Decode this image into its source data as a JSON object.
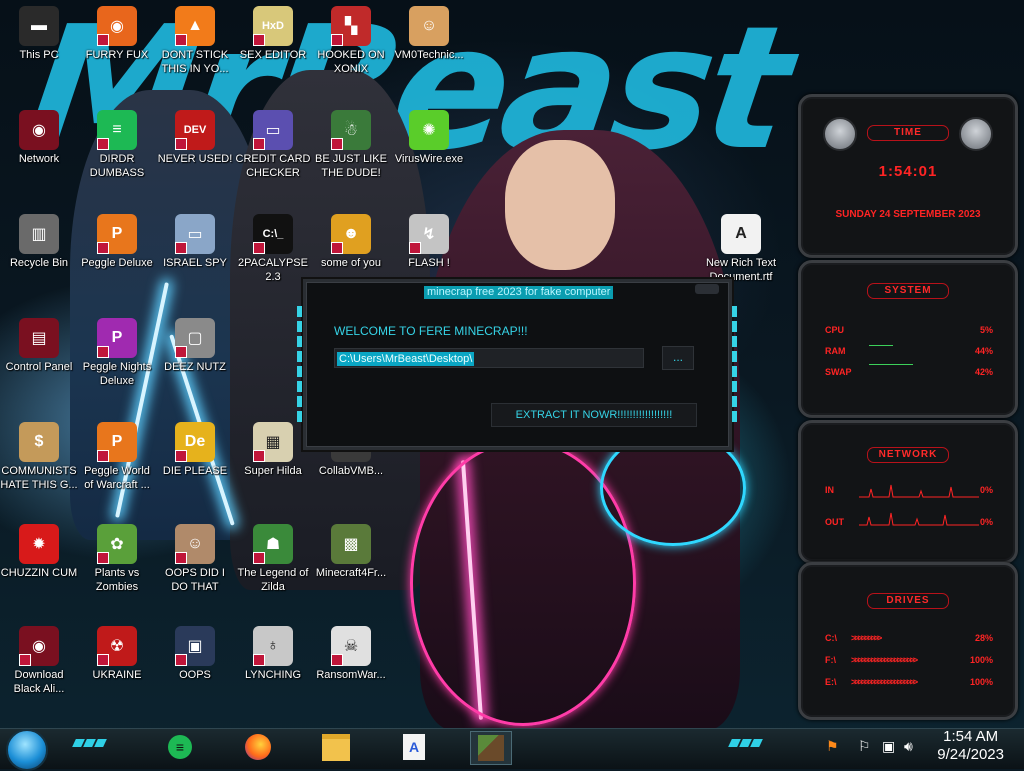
{
  "desktop": {
    "icons": [
      {
        "label": "This PC",
        "glyph": "▬",
        "bg": "#2a2a2a",
        "shortcut": false
      },
      {
        "label": "FURRY FUX",
        "glyph": "◉",
        "bg": "#e8661c",
        "shortcut": true
      },
      {
        "label": "DONT STICK THIS IN YO...",
        "glyph": "▲",
        "bg": "#f27b1a",
        "shortcut": true
      },
      {
        "label": "SEX EDITOR",
        "glyph": "HxD",
        "bg": "#d8c87a",
        "shortcut": true
      },
      {
        "label": "HOOKED ON XONIX",
        "glyph": "▚",
        "bg": "#c02a2a",
        "shortcut": true
      },
      {
        "label": "VM0Technic...",
        "glyph": "☺",
        "bg": "#d8a060",
        "shortcut": false
      },
      {
        "label": "Network",
        "glyph": "◉",
        "bg": "#7a1020",
        "shortcut": false
      },
      {
        "label": "DIRDR DUMBASS",
        "glyph": "≡",
        "bg": "#1db954",
        "shortcut": true
      },
      {
        "label": "NEVER USED!",
        "glyph": "DEV",
        "bg": "#c01a1a",
        "shortcut": true
      },
      {
        "label": "CREDIT CARD CHECKER",
        "glyph": "▭",
        "bg": "#5b4fb0",
        "shortcut": true
      },
      {
        "label": "BE JUST LIKE THE DUDE!",
        "glyph": "☃",
        "bg": "#3a7a3a",
        "shortcut": true
      },
      {
        "label": "VirusWire.exe",
        "glyph": "✺",
        "bg": "#5acd2a",
        "shortcut": false
      },
      {
        "label": "Recycle Bin",
        "glyph": "▥",
        "bg": "#6a6a6a",
        "shortcut": false
      },
      {
        "label": "Peggle Deluxe",
        "glyph": "P",
        "bg": "#e8761c",
        "shortcut": true
      },
      {
        "label": "ISRAEL SPY",
        "glyph": "▭",
        "bg": "#8aa6c8",
        "shortcut": true
      },
      {
        "label": "2PACALYPSE 2.3",
        "glyph": "C:\\_",
        "bg": "#111111",
        "shortcut": true
      },
      {
        "label": "some of you",
        "glyph": "☻",
        "bg": "#e0a020",
        "shortcut": true
      },
      {
        "label": "FLASH !",
        "glyph": "↯",
        "bg": "#c4c4c4",
        "shortcut": true
      },
      {
        "label": "Control Panel",
        "glyph": "▤",
        "bg": "#7a1020",
        "shortcut": false
      },
      {
        "label": "Peggle Nights Deluxe",
        "glyph": "P",
        "bg": "#a02ab0",
        "shortcut": true
      },
      {
        "label": "DEEZ NUTZ",
        "glyph": "▢",
        "bg": "#8a8a8a",
        "shortcut": true
      },
      {
        "label": "COMMUNISTS HATE THIS G...",
        "glyph": "$",
        "bg": "#c49a5a",
        "shortcut": false
      },
      {
        "label": "Peggle World of Warcraft ...",
        "glyph": "P",
        "bg": "#e8761c",
        "shortcut": true
      },
      {
        "label": "DIE PLEASE",
        "glyph": "De",
        "bg": "#e6b21c",
        "shortcut": true
      },
      {
        "label": "Super Hilda",
        "glyph": "▦",
        "bg": "#d8d0b0",
        "shortcut": true
      },
      {
        "label": "CollabVMB...",
        "glyph": "▧",
        "bg": "#3a3a3a",
        "shortcut": false
      },
      {
        "label": "CHUZZIN CUM",
        "glyph": "✹",
        "bg": "#d81a1a",
        "shortcut": false
      },
      {
        "label": "Plants vs Zombies",
        "glyph": "✿",
        "bg": "#5aa03a",
        "shortcut": true
      },
      {
        "label": "OOPS DID I DO THAT",
        "glyph": "☺",
        "bg": "#b08a6a",
        "shortcut": true
      },
      {
        "label": "The Legend of Zilda",
        "glyph": "☗",
        "bg": "#3a8a3a",
        "shortcut": true
      },
      {
        "label": "Minecraft4Fr...",
        "glyph": "▩",
        "bg": "#5a7a3a",
        "shortcut": false
      },
      {
        "label": "Download Black Ali...",
        "glyph": "◉",
        "bg": "#7a1020",
        "shortcut": true
      },
      {
        "label": "UKRAINE",
        "glyph": "☢",
        "bg": "#c01a1a",
        "shortcut": true
      },
      {
        "label": "OOPS",
        "glyph": "▣",
        "bg": "#2a3a5a",
        "shortcut": true
      },
      {
        "label": "LYNCHING",
        "glyph": "♁",
        "bg": "#c8c8c8",
        "shortcut": true
      },
      {
        "label": "RansomWar...",
        "glyph": "☠",
        "bg": "#e0e0e0",
        "shortcut": true
      },
      {
        "label": "New Rich Text Document.rtf",
        "glyph": "A",
        "bg": "#f2f2f2",
        "shortcut": false
      }
    ]
  },
  "dialog": {
    "title": "minecrap free 2023 for fake computer",
    "welcome": "WELCOME TO FERE MINECRAP!!!",
    "path": "C:\\Users\\MrBeast\\Desktop\\",
    "browse": "...",
    "extract": "EXTRACT IT NOWR!!!!!!!!!!!!!!!!!!"
  },
  "gadgets": {
    "time": {
      "header": "TIME",
      "clock": "1:54:01",
      "date": "SUNDAY 24 SEPTEMBER 2023"
    },
    "system": {
      "header": "SYSTEM",
      "rows": [
        {
          "k": "CPU",
          "v": "5%"
        },
        {
          "k": "RAM",
          "v": "44%"
        },
        {
          "k": "SWAP",
          "v": "42%"
        }
      ]
    },
    "network": {
      "header": "NETWORK",
      "rows": [
        {
          "k": "IN",
          "v": "0%"
        },
        {
          "k": "OUT",
          "v": "0%"
        }
      ]
    },
    "drives": {
      "header": "DRIVES",
      "rows": [
        {
          "k": "C:\\",
          "v": "28%"
        },
        {
          "k": "F:\\",
          "v": "100%"
        },
        {
          "k": "E:\\",
          "v": "100%"
        }
      ]
    }
  },
  "taskbar": {
    "time": "1:54 AM",
    "date": "9/24/2023"
  }
}
